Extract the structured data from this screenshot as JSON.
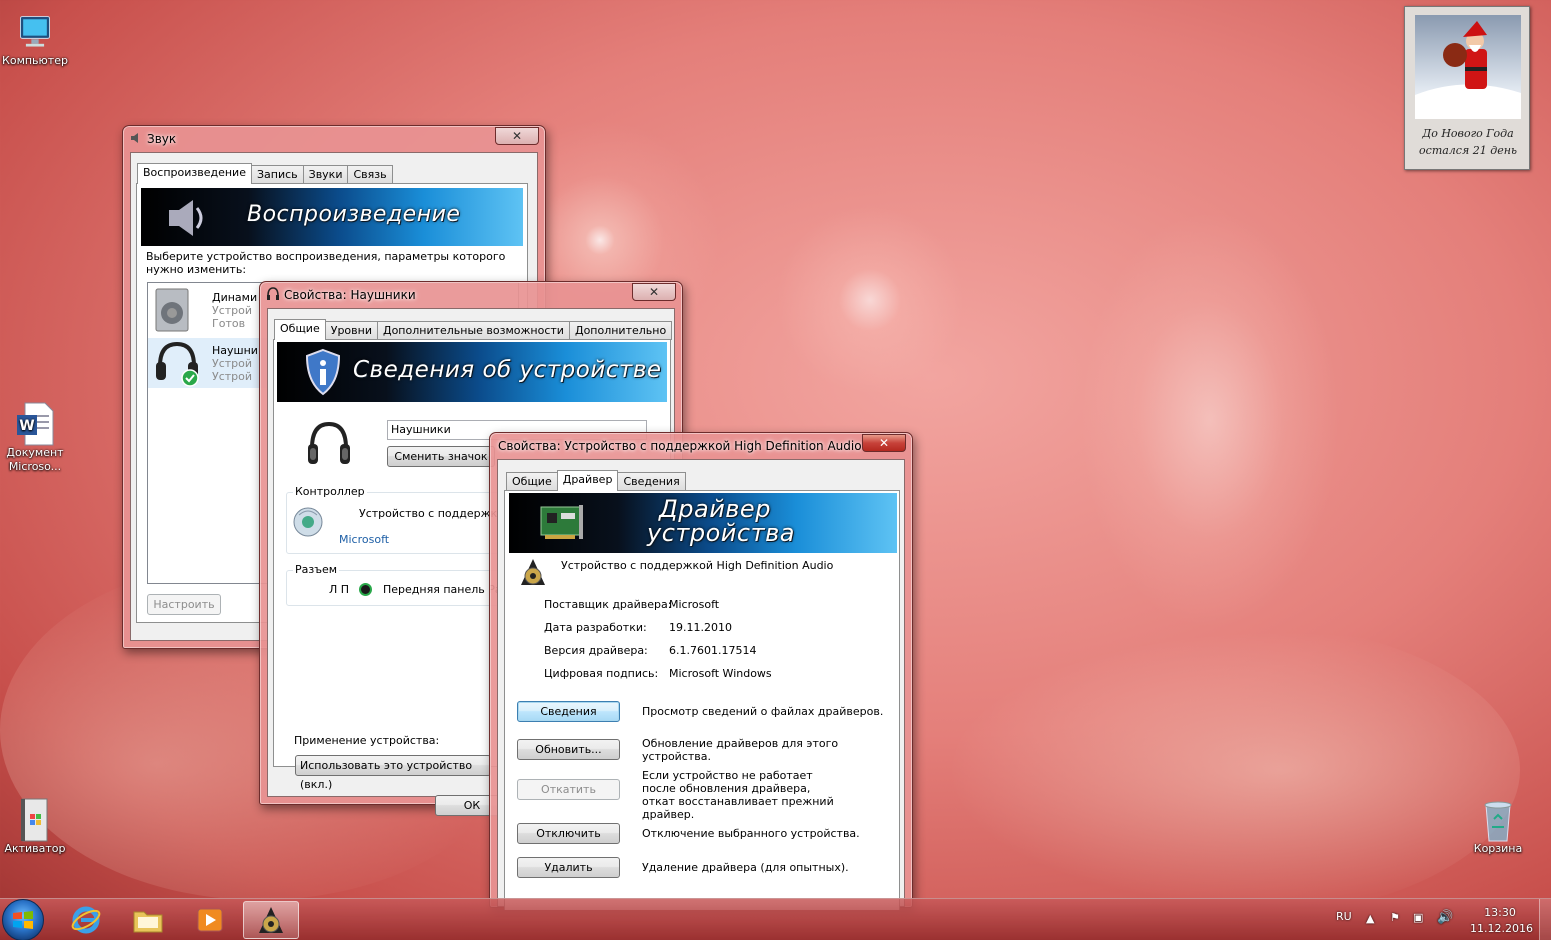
{
  "desktop": {
    "icons": [
      {
        "label": "Компьютер"
      },
      {
        "label": "Документ Microso..."
      },
      {
        "label": "Активатор"
      },
      {
        "label": "Корзина"
      }
    ],
    "gadget": {
      "line1": "До Нового Года",
      "line2": "остался 21 день"
    }
  },
  "sound_window": {
    "title": "Звук",
    "close": "✕",
    "tabs": [
      "Воспроизведение",
      "Запись",
      "Звуки",
      "Связь"
    ],
    "banner": "Воспроизведение",
    "instruction": "Выберите устройство воспроизведения, параметры которого нужно изменить:",
    "devices": [
      {
        "name": "Динами",
        "line2": "Устрой",
        "line3": "Готов"
      },
      {
        "name": "Наушни",
        "line2": "Устрой",
        "line3": "Устрой"
      }
    ],
    "configure_button": "Настроить"
  },
  "headphones_window": {
    "title": "Свойства: Наушники",
    "close": "✕",
    "tabs": [
      "Общие",
      "Уровни",
      "Дополнительные возможности",
      "Дополнительно"
    ],
    "banner": "Сведения об устройстве",
    "name_value": "Наушники",
    "change_icon_button": "Сменить значок",
    "controller_group": "Контроллер",
    "controller_name": "Устройство с поддержк",
    "controller_vendor": "Microsoft",
    "jack_group": "Разъем",
    "jack_lp": "Л П",
    "jack_label": "Передняя панель Ра",
    "usage_label": "Применение устройства:",
    "usage_value": "Использовать это устройство (вкл.)",
    "ok_button": "ОК"
  },
  "driver_window": {
    "title": "Свойства: Устройство с поддержкой High Definition Audio",
    "close": "✕",
    "tabs": [
      "Общие",
      "Драйвер",
      "Сведения"
    ],
    "banner_line1": "Драйвер",
    "banner_line2": "устройства",
    "device_name": "Устройство с поддержкой High Definition Audio",
    "props": [
      {
        "label": "Поставщик драйвера:",
        "value": "Microsoft"
      },
      {
        "label": "Дата разработки:",
        "value": "19.11.2010"
      },
      {
        "label": "Версия драйвера:",
        "value": "6.1.7601.17514"
      },
      {
        "label": "Цифровая подпись:",
        "value": "Microsoft Windows"
      }
    ],
    "actions": [
      {
        "button": "Сведения",
        "desc": "Просмотр сведений о файлах драйверов."
      },
      {
        "button": "Обновить...",
        "desc": "Обновление драйверов для этого устройства."
      },
      {
        "button": "Откатить",
        "desc": "Если устройство не работает после обновления драйвера, откат восстанавливает прежний драйвер."
      },
      {
        "button": "Отключить",
        "desc": "Отключение выбранного устройства."
      },
      {
        "button": "Удалить",
        "desc": "Удаление драйвера (для опытных)."
      }
    ]
  },
  "taskbar": {
    "language": "RU",
    "time": "13:30",
    "date": "11.12.2016"
  }
}
